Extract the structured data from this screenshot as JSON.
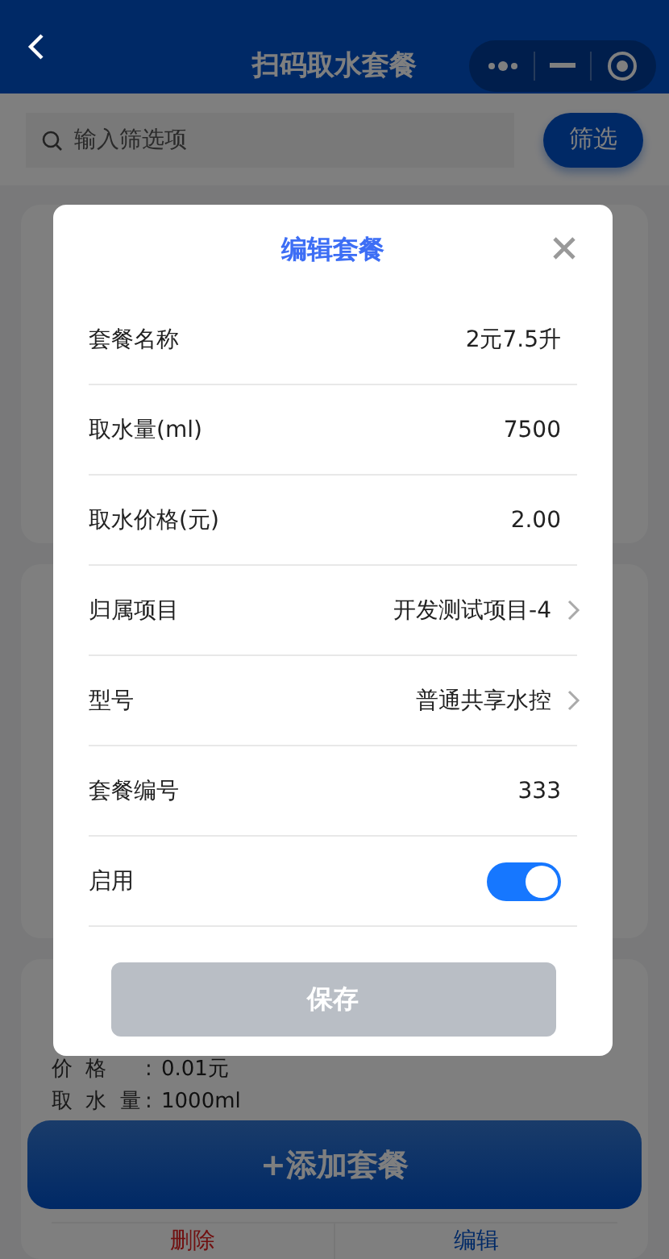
{
  "header": {
    "title": "扫码取水套餐"
  },
  "filter": {
    "placeholder": "输入筛选项",
    "button": "筛选"
  },
  "background_card": {
    "fields": [
      {
        "label": "价 格",
        "separator": ":",
        "value": "0.01元"
      },
      {
        "label": "取 水 量",
        "separator": ":",
        "value": "1000ml"
      }
    ]
  },
  "add_button": "+添加套餐",
  "card_actions": [
    {
      "label": "删除",
      "kind": "danger"
    },
    {
      "label": "编辑",
      "kind": "primary"
    }
  ],
  "dialog": {
    "title": "编辑套餐",
    "rows": [
      {
        "label": "套餐名称",
        "value": "2元7.5升",
        "kind": "text"
      },
      {
        "label": "取水量(ml)",
        "value": "7500",
        "kind": "text"
      },
      {
        "label": "取水价格(元)",
        "value": "2.00",
        "kind": "text"
      },
      {
        "label": "归属项目",
        "value": "开发测试项目-4",
        "kind": "select"
      },
      {
        "label": "型号",
        "value": "普通共享水控",
        "kind": "select"
      },
      {
        "label": "套餐编号",
        "value": "333",
        "kind": "text"
      },
      {
        "label": "启用",
        "kind": "switch",
        "on": true
      }
    ],
    "save_button": {
      "label": "保存",
      "disabled": true
    }
  }
}
